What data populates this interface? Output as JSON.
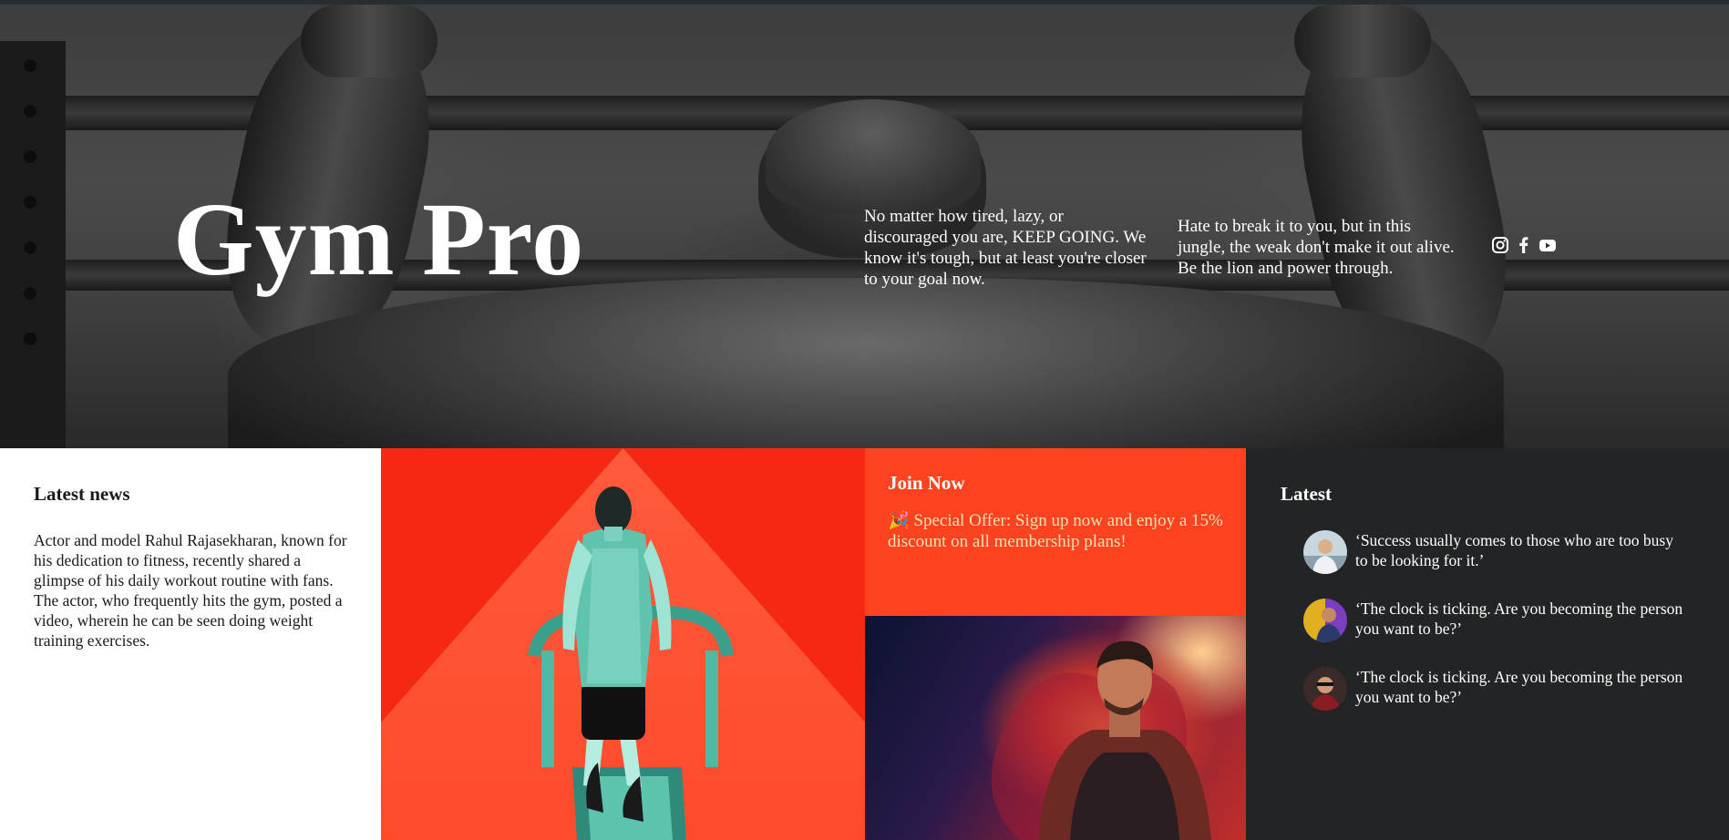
{
  "hero": {
    "brand": "Gym Pro",
    "quote_1": "No matter how tired, lazy, or discouraged you are, KEEP GOING. We know it's tough, but at least you're closer to your goal now.",
    "quote_2": "Hate to break it to you, but in this jungle, the weak don't make it out alive. Be the lion and power through.",
    "social_icons": [
      "instagram-icon",
      "facebook-icon",
      "youtube-icon"
    ]
  },
  "news": {
    "heading": "Latest news",
    "body": "Actor and model Rahul Rajasekharan, known for his dedication to fitness, recently shared a glimpse of his daily workout routine with fans. The actor, who frequently hits the gym, posted a video, wherein he can be seen doing weight training exercises."
  },
  "join": {
    "heading": "Join Now",
    "offer": "🎉 Special Offer: Sign up now and enjoy a 15% discount on all membership plans!"
  },
  "latest": {
    "heading": "Latest",
    "items": [
      {
        "text": "‘Success usually comes to those who are too busy to be looking for it.’"
      },
      {
        "text": "‘The clock is ticking. Are you becoming the person you want to be?’"
      },
      {
        "text": "‘The clock is ticking. Are you becoming the person you want to be?’"
      }
    ]
  },
  "colors": {
    "accent_red": "#f52814",
    "join_orange": "#ff4320",
    "offer_text": "#ffe2b0",
    "dark_panel": "#222425"
  }
}
